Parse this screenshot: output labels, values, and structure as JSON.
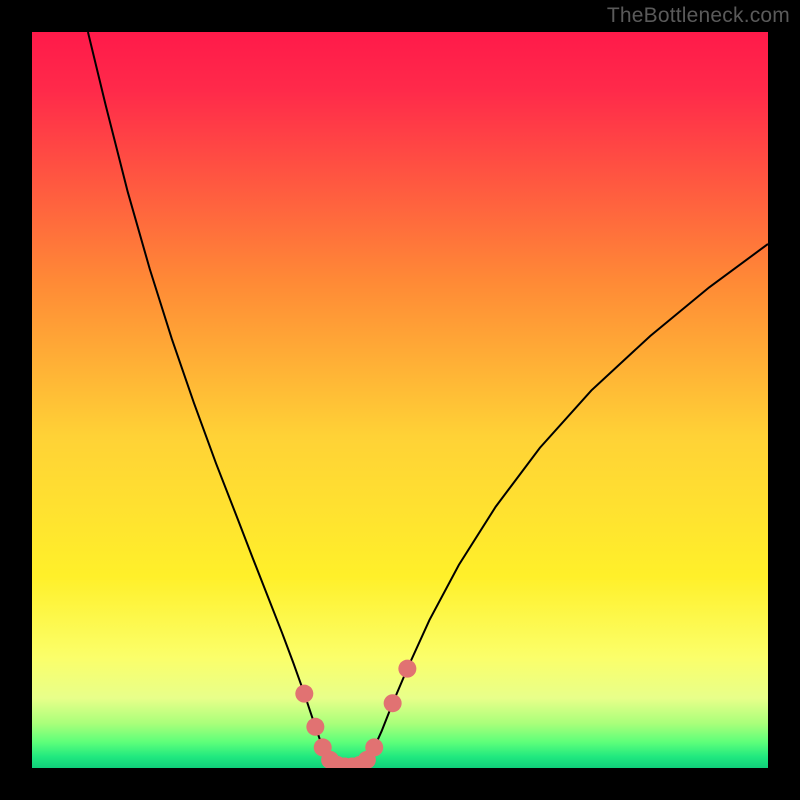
{
  "watermark": "TheBottleneck.com",
  "palette": {
    "black": "#000000",
    "curve_stroke": "#000000",
    "marker_fill": "#e17272",
    "gradient_stops": [
      {
        "offset": 0.0,
        "color": "#ff1a4a"
      },
      {
        "offset": 0.08,
        "color": "#ff2a4a"
      },
      {
        "offset": 0.34,
        "color": "#ff8a36"
      },
      {
        "offset": 0.55,
        "color": "#ffd236"
      },
      {
        "offset": 0.74,
        "color": "#fff02a"
      },
      {
        "offset": 0.85,
        "color": "#fbff6a"
      },
      {
        "offset": 0.905,
        "color": "#e8ff8a"
      },
      {
        "offset": 0.94,
        "color": "#a8ff7a"
      },
      {
        "offset": 0.965,
        "color": "#5dff7a"
      },
      {
        "offset": 0.985,
        "color": "#20e87f"
      },
      {
        "offset": 1.0,
        "color": "#10cf7a"
      }
    ]
  },
  "chart_data": {
    "type": "line",
    "title": "",
    "xlabel": "",
    "ylabel": "",
    "xlim": [
      0,
      100
    ],
    "ylim": [
      0,
      100
    ],
    "grid": false,
    "curve_points": [
      {
        "x": 7.6,
        "y": 100.0
      },
      {
        "x": 10.0,
        "y": 90.1
      },
      {
        "x": 13.0,
        "y": 78.3
      },
      {
        "x": 16.0,
        "y": 67.8
      },
      {
        "x": 19.0,
        "y": 58.3
      },
      {
        "x": 22.0,
        "y": 49.6
      },
      {
        "x": 25.0,
        "y": 41.4
      },
      {
        "x": 28.0,
        "y": 33.7
      },
      {
        "x": 30.0,
        "y": 28.5
      },
      {
        "x": 32.0,
        "y": 23.4
      },
      {
        "x": 34.0,
        "y": 18.3
      },
      {
        "x": 35.5,
        "y": 14.3
      },
      {
        "x": 37.0,
        "y": 10.1
      },
      {
        "x": 38.5,
        "y": 5.6
      },
      {
        "x": 39.5,
        "y": 2.8
      },
      {
        "x": 40.5,
        "y": 1.1
      },
      {
        "x": 41.5,
        "y": 0.4
      },
      {
        "x": 42.5,
        "y": 0.2
      },
      {
        "x": 43.5,
        "y": 0.2
      },
      {
        "x": 44.5,
        "y": 0.4
      },
      {
        "x": 45.5,
        "y": 1.1
      },
      {
        "x": 46.5,
        "y": 2.8
      },
      {
        "x": 47.5,
        "y": 5.0
      },
      {
        "x": 49.0,
        "y": 8.8
      },
      {
        "x": 51.0,
        "y": 13.5
      },
      {
        "x": 54.0,
        "y": 20.1
      },
      {
        "x": 58.0,
        "y": 27.6
      },
      {
        "x": 63.0,
        "y": 35.5
      },
      {
        "x": 69.0,
        "y": 43.5
      },
      {
        "x": 76.0,
        "y": 51.3
      },
      {
        "x": 84.0,
        "y": 58.7
      },
      {
        "x": 92.0,
        "y": 65.3
      },
      {
        "x": 100.0,
        "y": 71.2
      }
    ],
    "markers": [
      {
        "x": 37.0,
        "y": 10.1
      },
      {
        "x": 38.5,
        "y": 5.6
      },
      {
        "x": 39.5,
        "y": 2.8
      },
      {
        "x": 40.5,
        "y": 1.1
      },
      {
        "x": 41.5,
        "y": 0.4
      },
      {
        "x": 42.5,
        "y": 0.2
      },
      {
        "x": 43.5,
        "y": 0.2
      },
      {
        "x": 44.5,
        "y": 0.4
      },
      {
        "x": 45.5,
        "y": 1.1
      },
      {
        "x": 46.5,
        "y": 2.8
      },
      {
        "x": 49.0,
        "y": 8.8
      },
      {
        "x": 51.0,
        "y": 13.5
      }
    ]
  }
}
